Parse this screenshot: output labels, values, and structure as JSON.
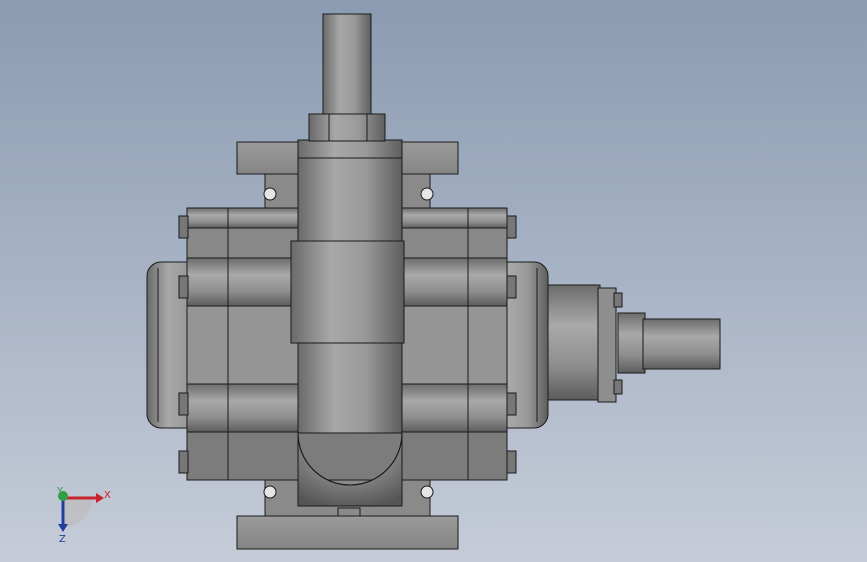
{
  "viewport": {
    "background_top": "#8b9bb1",
    "background_bottom": "#c6ccd8"
  },
  "model": {
    "body_color": "#8e8e8e",
    "shade_color": "#6f6f6f",
    "highlight_color": "#b4b4b4",
    "edge_color": "#1a1a1a"
  },
  "triad": {
    "x_label": "X",
    "y_label": "Y",
    "z_label": "Z",
    "x_color": "#c8242b",
    "y_color": "#2ea043",
    "z_color": "#1f3f9f"
  }
}
